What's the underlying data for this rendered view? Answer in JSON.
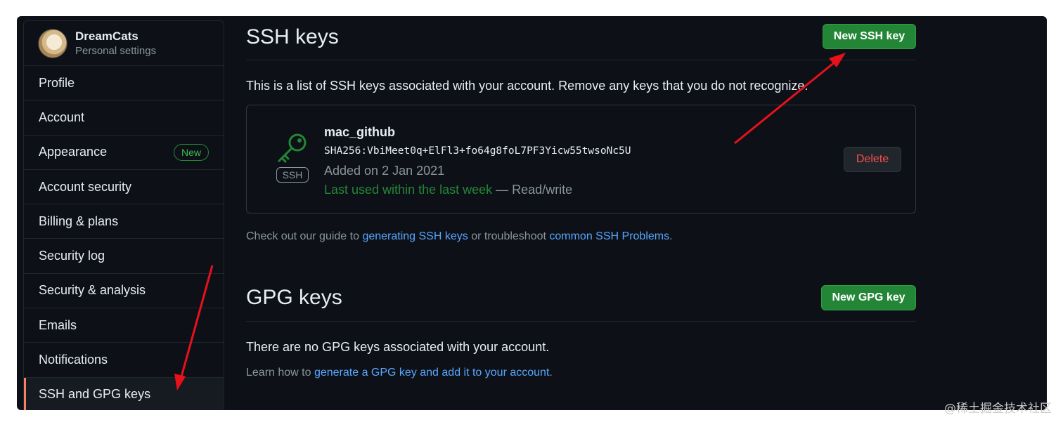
{
  "sidebar": {
    "profile": {
      "name": "DreamCats",
      "subtitle": "Personal settings"
    },
    "items": [
      {
        "label": "Profile"
      },
      {
        "label": "Account"
      },
      {
        "label": "Appearance",
        "badge": "New"
      },
      {
        "label": "Account security"
      },
      {
        "label": "Billing & plans"
      },
      {
        "label": "Security log"
      },
      {
        "label": "Security & analysis"
      },
      {
        "label": "Emails"
      },
      {
        "label": "Notifications"
      },
      {
        "label": "SSH and GPG keys",
        "selected": true
      }
    ]
  },
  "ssh": {
    "title": "SSH keys",
    "new_button": "New SSH key",
    "description": "This is a list of SSH keys associated with your account. Remove any keys that you do not recognize.",
    "key": {
      "badge": "SSH",
      "title": "mac_github",
      "fingerprint": "SHA256:VbiMeet0q+ElFl3+fo64g8foL7PF3Yicw55twsoNc5U",
      "added": "Added on 2 Jan 2021",
      "last_used": "Last used within the last week",
      "separator": " — ",
      "access": "Read/write",
      "delete_button": "Delete"
    },
    "help": {
      "prefix": "Check out our guide to ",
      "link1": "generating SSH keys",
      "middle": " or troubleshoot ",
      "link2": "common SSH Problems",
      "suffix": "."
    }
  },
  "gpg": {
    "title": "GPG keys",
    "new_button": "New GPG key",
    "empty_text": "There are no GPG keys associated with your account.",
    "help": {
      "prefix": "Learn how to ",
      "link": "generate a GPG key and add it to your account",
      "suffix": "."
    }
  },
  "watermark": "@稀土掘金技术社区",
  "colors": {
    "background": "#0d1117",
    "accent_green": "#238636",
    "link_blue": "#58a6ff",
    "danger_red": "#f85149",
    "selected_marker": "#f78166",
    "annotation_arrow": "#e8111b"
  }
}
